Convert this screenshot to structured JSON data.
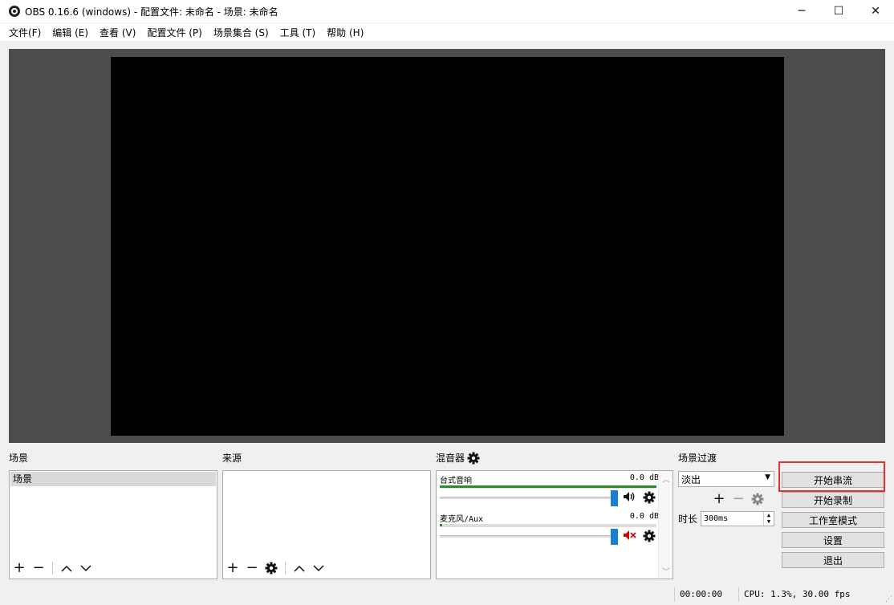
{
  "window": {
    "title": "OBS 0.16.6 (windows) - 配置文件: 未命名 - 场景: 未命名",
    "minimize": "─",
    "maximize": "☐",
    "close": "✕"
  },
  "menu": [
    "文件(F)",
    "编辑 (E)",
    "查看 (V)",
    "配置文件 (P)",
    "场景集合 (S)",
    "工具 (T)",
    "帮助 (H)"
  ],
  "docks": {
    "scenes_title": "场景",
    "sources_title": "来源",
    "mixer_title": "混音器",
    "transitions_title": "场景过渡"
  },
  "scenes": {
    "items": [
      "场景"
    ]
  },
  "mixer": {
    "channels": [
      {
        "name": "台式音响",
        "db": "0.0 dB",
        "muted": false
      },
      {
        "name": "麦克风/Aux",
        "db": "0.0 dB",
        "muted": true
      }
    ]
  },
  "transitions": {
    "selected": "淡出",
    "duration_label": "时长",
    "duration_value": "300ms"
  },
  "controls": {
    "start_streaming": "开始串流",
    "start_recording": "开始录制",
    "studio_mode": "工作室模式",
    "settings": "设置",
    "exit": "退出"
  },
  "status": {
    "time": "00:00:00",
    "cpu_fps": "CPU: 1.3%, 30.00 fps"
  },
  "colors": {
    "preview_bg": "#4c4c4c",
    "canvas": "#000000",
    "meter": "#2a8c2a",
    "slider_handle": "#1a7ed6",
    "muted_icon": "#cc0000",
    "highlight": "#e03030"
  },
  "icons": {
    "gear": "gear-icon",
    "speaker": "speaker-icon",
    "speaker_muted": "speaker-muted-icon",
    "add": "plus-icon",
    "remove": "minus-icon",
    "up": "chevron-up-icon",
    "down": "chevron-down-icon"
  }
}
